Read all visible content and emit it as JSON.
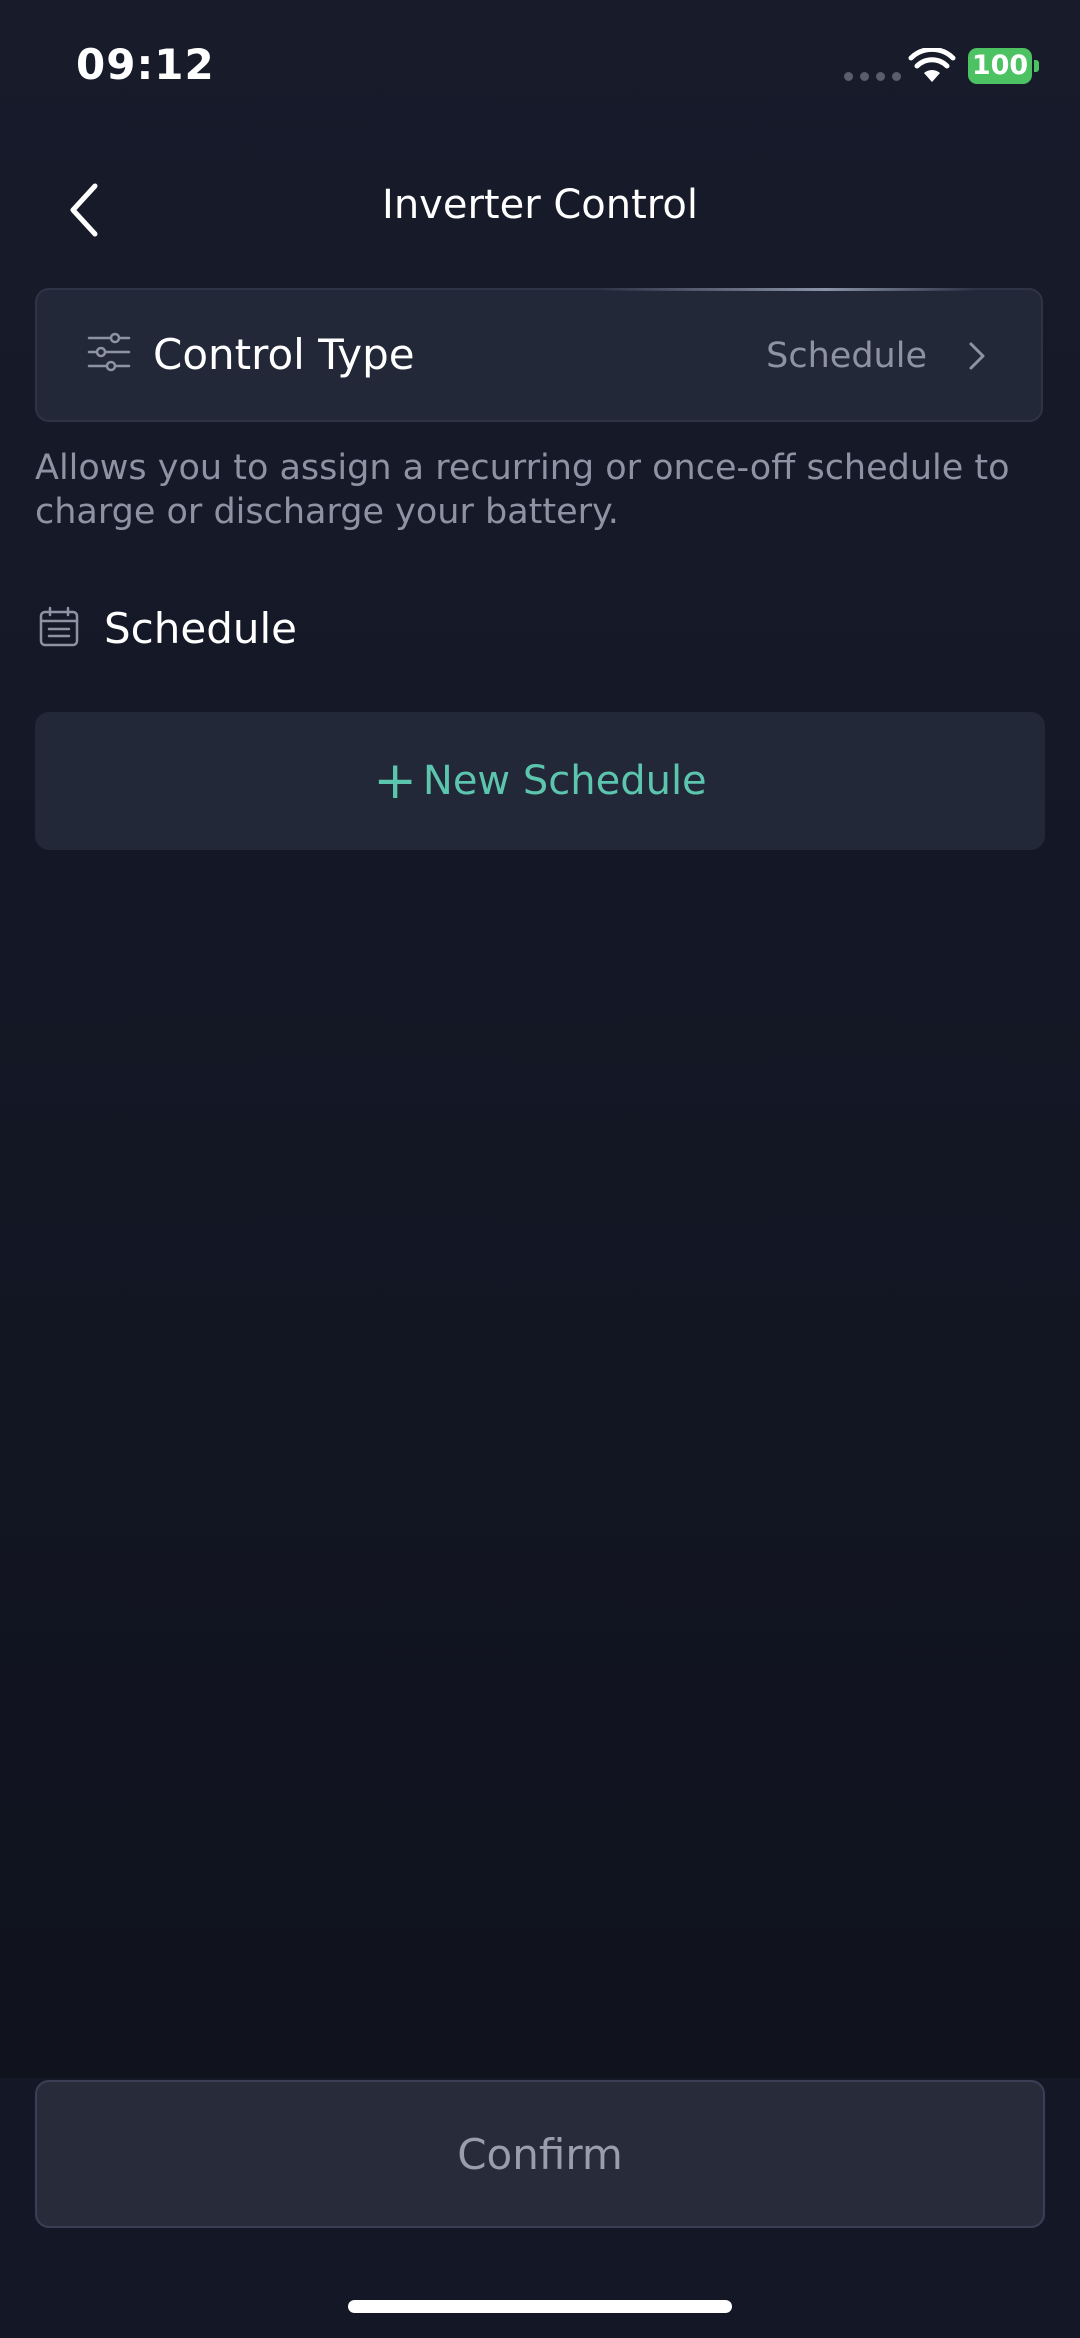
{
  "status_bar": {
    "time": "09:12",
    "battery": "100",
    "battery_color": "#4cc262",
    "icons": [
      "signal-dots-icon",
      "wifi-icon",
      "battery-icon"
    ]
  },
  "nav": {
    "title": "Inverter Control",
    "back_icon": "chevron-left-icon"
  },
  "control_type": {
    "label": "Control Type",
    "value": "Schedule",
    "icon": "sliders-icon",
    "chevron_icon": "chevron-right-icon"
  },
  "description": "Allows you to assign a recurring or once-off schedule to charge or discharge your battery.",
  "schedule_section": {
    "title": "Schedule",
    "icon": "calendar-icon"
  },
  "new_schedule": {
    "plus": "+",
    "label": "New Schedule",
    "accent_color": "#5bc6ad"
  },
  "confirm": {
    "label": "Confirm"
  }
}
